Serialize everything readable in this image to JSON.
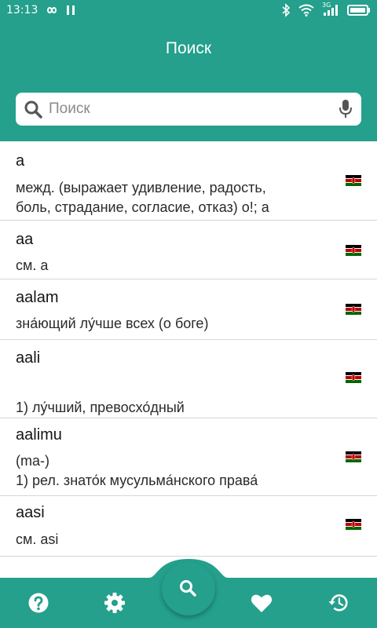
{
  "status_bar": {
    "time": "13:13",
    "network_type": "3G",
    "icons": [
      "infinity-icon",
      "pause-icon",
      "bluetooth-icon",
      "wifi-icon",
      "signal-icon",
      "battery-icon"
    ]
  },
  "header": {
    "title": "Поиск",
    "search_placeholder": "Поиск",
    "search_value": ""
  },
  "entries": [
    {
      "word": "a",
      "lines": [
        "межд. (выражает удивление, радость,",
        "боль, страдание, согласие, отказ) о!; а"
      ],
      "flag": "kenya-flag-icon"
    },
    {
      "word": "aa",
      "lines": [
        "см. a"
      ],
      "flag": "kenya-flag-icon"
    },
    {
      "word": "aalam",
      "lines": [
        "зна́ющий лу́чше всех (о боге)"
      ],
      "flag": "kenya-flag-icon"
    },
    {
      "word": "aali",
      "lines": [
        "",
        "1) лу́чший, превосхо́дный"
      ],
      "flag": "kenya-flag-icon"
    },
    {
      "word": "aalimu",
      "lines": [
        "(ma-)",
        "1) рел. знато́к мусульма́нского права́"
      ],
      "flag": "kenya-flag-icon"
    },
    {
      "word": "aasi",
      "lines": [
        "см. asi"
      ],
      "flag": "kenya-flag-icon"
    }
  ],
  "bottom_nav": {
    "items": [
      "help-icon",
      "settings-icon",
      "search-icon",
      "favorites-icon",
      "history-icon"
    ],
    "active": "search-icon"
  },
  "colors": {
    "accent": "#24a08c",
    "text": "#202020",
    "divider": "#d6d6d6"
  }
}
